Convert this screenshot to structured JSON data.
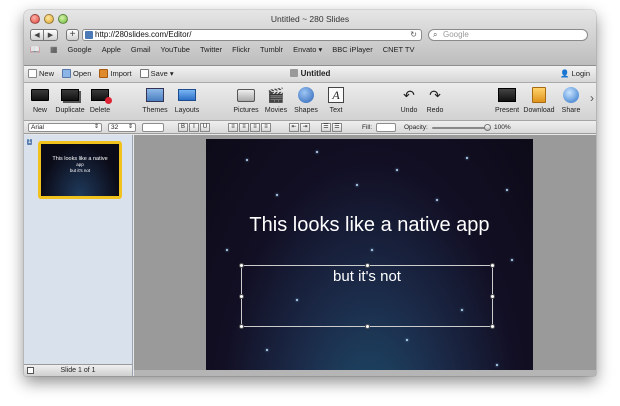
{
  "browser": {
    "window_title": "Untitled ~ 280 Slides",
    "url": "http://280slides.com/Editor/",
    "search_placeholder": "Google",
    "back": "◀",
    "forward": "▶",
    "add": "+",
    "bookmarks": [
      "Google",
      "Apple",
      "Gmail",
      "YouTube",
      "Twitter",
      "Flickr",
      "Tumblr",
      "Envato ▾",
      "BBC iPlayer",
      "CNET TV"
    ]
  },
  "appbar": {
    "new_label": "New",
    "open_label": "Open",
    "import_label": "Import",
    "save_label": "Save ▾",
    "document_title": "Untitled",
    "login_label": "Login"
  },
  "toolbar": {
    "new": "New",
    "duplicate": "Duplicate",
    "delete": "Delete",
    "themes": "Themes",
    "layouts": "Layouts",
    "pictures": "Pictures",
    "movies": "Movies",
    "shapes": "Shapes",
    "text": "Text",
    "undo": "Undo",
    "redo": "Redo",
    "present": "Present",
    "download": "Download",
    "share": "Share"
  },
  "format": {
    "font": "Arial",
    "size": "32",
    "bold": "B",
    "italic": "I",
    "underline": "U",
    "fill_label": "Fill:",
    "opacity_label": "Opacity:",
    "opacity_value": "100%",
    "opacity_fraction": 1.0
  },
  "sidebar": {
    "thumb_number": "1",
    "thumb_title": "This looks like a native",
    "thumb_title2": "app",
    "thumb_sub": "but it's not",
    "footer": "Slide 1 of 1"
  },
  "slide": {
    "title": "This looks like a native app",
    "subtitle": "but it's not"
  }
}
